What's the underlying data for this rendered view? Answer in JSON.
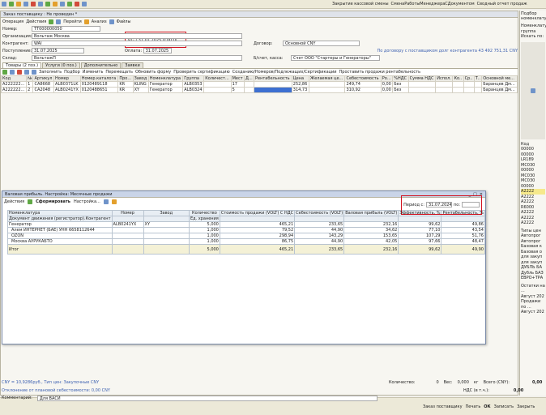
{
  "topbar": {
    "items": [
      "Закрытие кассовой смены",
      "СменаРаботыМенеджераСДокументом",
      "Сводный отчет продаж"
    ]
  },
  "doc": {
    "title": "Заказ поставщику : Не проведен *",
    "menu": [
      "Операция",
      "Действия",
      "Перейти",
      "Анализ",
      "Файлы"
    ],
    "date_label": "от:",
    "date_value": "31.07.2025 0:00:00",
    "fields": [
      {
        "label": "Номер:",
        "value": "ТТ000000050"
      },
      {
        "label": "Организация:",
        "value": "Вольтаж Москва"
      },
      {
        "label": "Контрагент:",
        "value": "WAI"
      },
      {
        "label": "Поступление:",
        "value": "31.07.2025"
      },
      {
        "label": "Склад:",
        "value": "ВольтажП"
      }
    ],
    "payment_label": "Оплата:",
    "payment_value": "31.07.2025",
    "contract_label": "Договор:",
    "contract_value": "Основной CNY",
    "contract_note": "По договору с поставщиком долг контрагента 43 492 751,31 CNY",
    "cash_label": "Б/счет, касса:",
    "cash_value": "Счет ООО \"Стартеры и Генераторы\"",
    "tabs": [
      "Товары (2 поз.)",
      "Услуги (0 поз.)",
      "Дополнительно",
      "Заявки"
    ],
    "table_toolbar": [
      "Заполнить",
      "Подбор",
      "Изменить",
      "Перемещать",
      "Обновить форму",
      "Проверить сертификацию",
      "Созданию/Номеров/Подлежащих/Сертификации",
      "Проставить продажи рентабельность"
    ],
    "columns": [
      "Код",
      "№",
      "Артикул",
      "Номер",
      "Номер.каталога",
      "Про...",
      "Завод",
      "Номенклатура",
      "Группа",
      "Количест...",
      "Мест",
      "Д...",
      "Рентабельность",
      "Цена",
      "Желаемая це...",
      "Себестоимость",
      "Ро...",
      "%НДС",
      "Сумма НДС",
      "Испол.",
      "Ко..",
      "Ср..",
      "Т..",
      "Основной ме..."
    ],
    "rows": [
      [
        "А222222...",
        "1",
        "СА8668",
        "ALB0371LK",
        "0120489118",
        "KR",
        "KLING",
        "Генератор",
        "ALB0353",
        "",
        "17",
        "",
        "",
        "252,86",
        "",
        "249,74",
        "0,00",
        "Без",
        "",
        "",
        "",
        "",
        "",
        "Баранцев Дм..."
      ],
      [
        "А222222...",
        "2",
        "СА2048",
        "ALB0241YX",
        "0120488651",
        "KR",
        "XY",
        "Генератор",
        "ALB0324",
        "",
        "5",
        "",
        "",
        "314,73",
        "",
        "310,92",
        "0,00",
        "Без",
        "",
        "",
        "",
        "",
        "",
        "Баранцев Дм..."
      ]
    ]
  },
  "dialog": {
    "title": "Валовая прибыль. Настройка: Месячные продажи",
    "toolbar": [
      "Действия",
      "Сформировать",
      "Настройка..."
    ],
    "period_label": "Период с:",
    "period_from": "31.07.2024",
    "period_to_label": "по:",
    "period_to": "",
    "headers": [
      "Номенклатура",
      "Номер",
      "Завод",
      "Количество",
      "Стоимость продажи (VOLT) С НДС",
      "Себестоимость (VOLT)",
      "Валовая прибыль (VOLT)",
      "Эффективность, %",
      "Рентабельность, %"
    ],
    "subheaders": [
      "Документ движения (регистратор).Контрагент",
      "",
      "",
      "Ед. хранения",
      "",
      "",
      "",
      "",
      ""
    ],
    "rows": [
      [
        "Генератор",
        "ALB0241YX",
        "XY",
        "5,000",
        "465,21",
        "233,65",
        "232,16",
        "99,62",
        "49,86"
      ],
      [
        "Алем ИНТЕРНЕТ (БАЕ) УНН 6658112644",
        "",
        "",
        "1,000",
        "79,52",
        "44,90",
        "34,62",
        "77,10",
        "43,54"
      ],
      [
        "OZON",
        "",
        "",
        "1,000",
        "298,94",
        "143,29",
        "153,65",
        "107,29",
        "51,76"
      ],
      [
        "Москва АУРУКАБТО",
        "",
        "",
        "1,000",
        "86,75",
        "44,90",
        "42,05",
        "97,66",
        "48,47"
      ],
      [
        "Итог",
        "",
        "",
        "5,000",
        "465,21",
        "233,65",
        "232,16",
        "99,62",
        "49,90"
      ]
    ]
  },
  "sidebar": {
    "title": "Подбор номенклатуры",
    "lines": [
      "Номенклатура",
      "группа",
      "Искать по:",
      "Код",
      "00000",
      "00000",
      "LR189",
      "МС030",
      "00000",
      "МС030",
      "МС030",
      "00000",
      "А2222",
      "А2222",
      "А2222",
      "R6000",
      "А2222",
      "А2222",
      "А2222",
      "Типы цен",
      "Автопрог",
      "Автопрог",
      "Базовая к",
      "Базовая о",
      "для закуп",
      "для закуп",
      "ДУБЛЬ БА",
      "Дубль БАЗ",
      "ЕВРО+ТРА",
      "Остатки на ...",
      "Август 202",
      "Продажи по ...",
      "Август 202"
    ]
  },
  "status": {
    "left": "CNY = 10,9286руб., Тип цен: Закупочные CNY",
    "cost_note": "Отклонение от плановой себестоимости: 0,00 CNY",
    "comment_label": "Комментарий:",
    "comment": "Для ВАСИ",
    "qty_label": "Количество:",
    "qty": "0",
    "weight_label": "Вес:",
    "weight": "0,000",
    "weight_unit": "кг",
    "total_label": "Всего (CNY):",
    "total": "0,00",
    "vat_label": "НДС (в т.ч.):",
    "vat": "0,00",
    "buttons": [
      "Заказ поставщику",
      "Печать",
      "ОК",
      "Записать",
      "Закрыть"
    ]
  }
}
